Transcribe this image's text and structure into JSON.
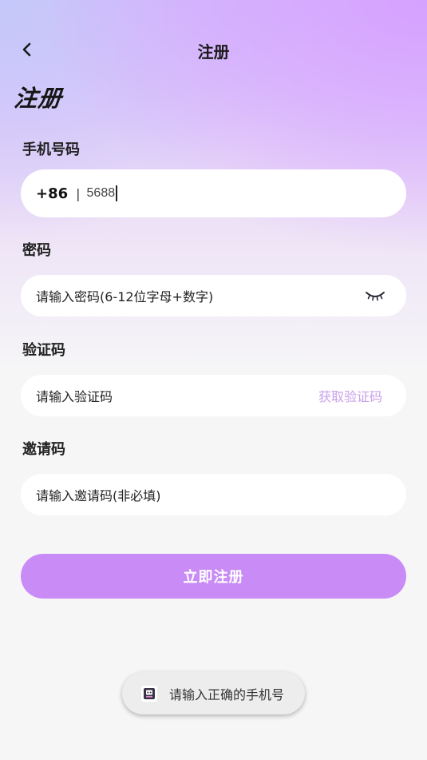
{
  "header": {
    "title": "注册",
    "back_icon": "chevron-left-icon"
  },
  "page_title": "注册",
  "phone": {
    "label": "手机号码",
    "country_code": "+86",
    "separator": "|",
    "value": "5688"
  },
  "password": {
    "label": "密码",
    "placeholder": "请输入密码(6-12位字母+数字)",
    "visibility_icon": "eye-closed-icon"
  },
  "verification": {
    "label": "验证码",
    "placeholder": "请输入验证码",
    "get_code_label": "获取验证码"
  },
  "invite": {
    "label": "邀请码",
    "placeholder": "请输入邀请码(非必填)"
  },
  "submit_label": "立即注册",
  "toast": {
    "icon": "app-logo-icon",
    "text": "请输入正确的手机号"
  },
  "colors": {
    "accent": "#c98cf7",
    "link": "#c9a0ea",
    "background": "#f6f6f7"
  }
}
